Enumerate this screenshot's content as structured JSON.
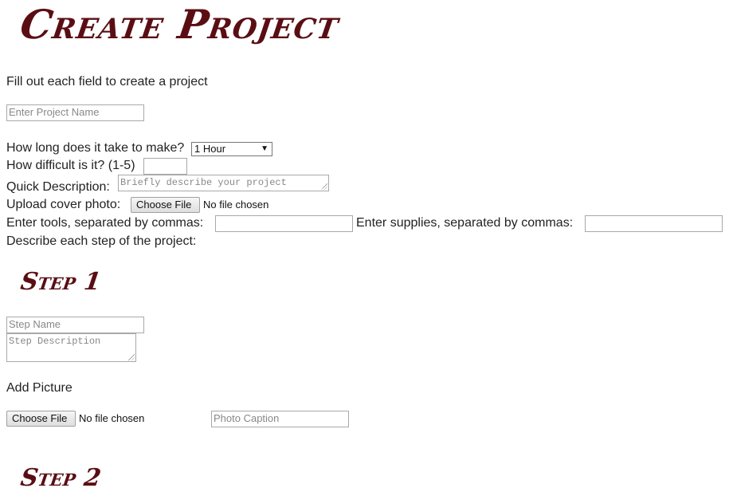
{
  "header": {
    "title": "Create Project"
  },
  "intro": {
    "text": "Fill out each field to create a project"
  },
  "project": {
    "name_placeholder": "Enter Project Name",
    "time_label": "How long does it take to make?",
    "time_selected": "1 Hour",
    "difficulty_label": "How difficult is it? (1-5)",
    "difficulty_value": "",
    "description_label": "Quick Description:",
    "description_placeholder": "Briefly describe your project",
    "cover_label": "Upload cover photo:",
    "cover_button": "Choose File",
    "cover_status": "No file chosen",
    "tools_label": "Enter tools, separated by commas:",
    "supplies_label": "Enter supplies, separated by commas:",
    "steps_label": "Describe each step of the project:"
  },
  "steps": [
    {
      "heading": "Step 1",
      "name_placeholder": "Step Name",
      "description_placeholder": "Step Description",
      "add_picture_label": "Add Picture",
      "file_button": "Choose File",
      "file_status": "No file chosen",
      "caption_placeholder": "Photo Caption"
    },
    {
      "heading": "Step 2"
    }
  ],
  "colors": {
    "heading": "#5a0e14"
  }
}
